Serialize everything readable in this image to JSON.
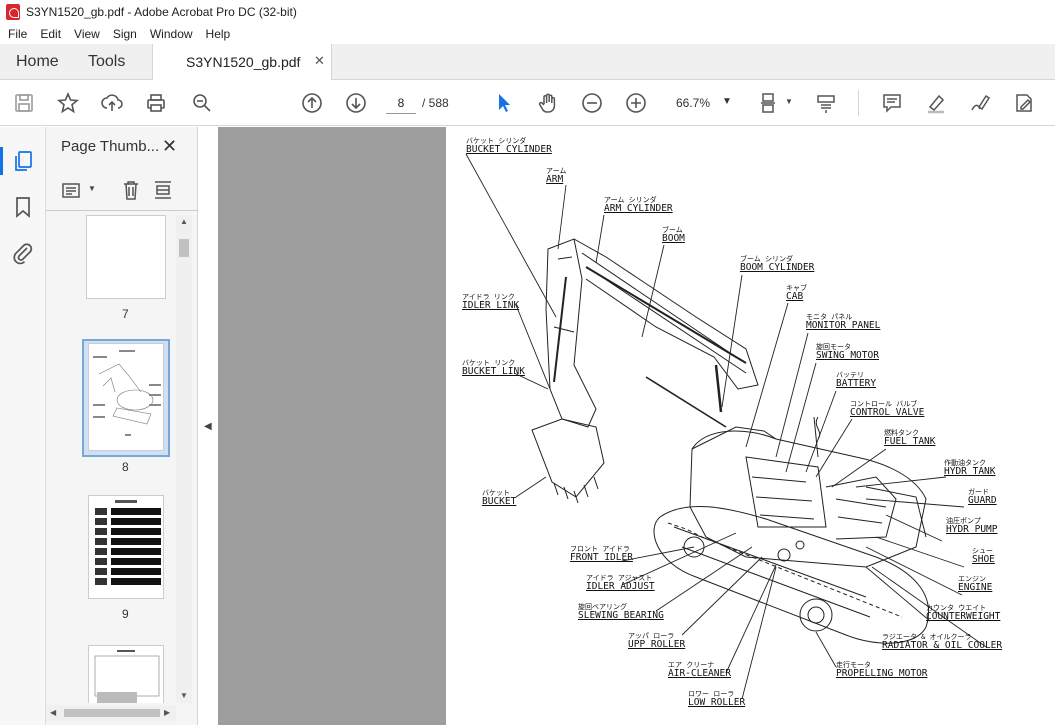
{
  "window": {
    "title": "S3YN1520_gb.pdf - Adobe Acrobat Pro DC (32-bit)"
  },
  "menu": [
    "File",
    "Edit",
    "View",
    "Sign",
    "Window",
    "Help"
  ],
  "tabs": {
    "home": "Home",
    "tools": "Tools",
    "document": "S3YN1520_gb.pdf"
  },
  "toolbar": {
    "page_current": "8",
    "page_total": "/ 588",
    "zoom": "66.7%"
  },
  "thumbnails": {
    "title": "Page Thumb...",
    "pages": [
      {
        "label": "7"
      },
      {
        "label": "8",
        "selected": true
      },
      {
        "label": "9"
      }
    ]
  },
  "diagram_labels": [
    {
      "jp": "バケット シリンダ",
      "en": "BUCKET CYLINDER"
    },
    {
      "jp": "アーム",
      "en": "ARM"
    },
    {
      "jp": "アーム シリンダ",
      "en": "ARM CYLINDER"
    },
    {
      "jp": "ブーム",
      "en": "BOOM"
    },
    {
      "jp": "ブーム シリンダ",
      "en": "BOOM CYLINDER"
    },
    {
      "jp": "キャブ",
      "en": "CAB"
    },
    {
      "jp": "モニタ パネル",
      "en": "MONITOR PANEL"
    },
    {
      "jp": "旋回モータ",
      "en": "SWING MOTOR"
    },
    {
      "jp": "バッテリ",
      "en": "BATTERY"
    },
    {
      "jp": "コントロール バルブ",
      "en": "CONTROL VALVE"
    },
    {
      "jp": "燃料タンク",
      "en": "FUEL TANK"
    },
    {
      "jp": "作動油タンク",
      "en": "HYDR TANK"
    },
    {
      "jp": "ガード",
      "en": "GUARD"
    },
    {
      "jp": "油圧ポンプ",
      "en": "HYDR PUMP"
    },
    {
      "jp": "シュー",
      "en": "SHOE"
    },
    {
      "jp": "エンジン",
      "en": "ENGINE"
    },
    {
      "jp": "カウンタ ウエイト",
      "en": "COUNTERWEIGHT"
    },
    {
      "jp": "ラジエータ & オイルクーラ",
      "en": "RADIATOR & OIL COOLER"
    },
    {
      "jp": "走行モータ",
      "en": "PROPELLING MOTOR"
    },
    {
      "jp": "ロワー ローラ",
      "en": "LOW ROLLER"
    },
    {
      "jp": "エア クリーナ",
      "en": "AIR-CLEANER"
    },
    {
      "jp": "アッパ ローラ",
      "en": "UPP ROLLER"
    },
    {
      "jp": "旋回ベアリング",
      "en": "SLEWING BEARING"
    },
    {
      "jp": "アイドラ アジャスト",
      "en": "IDLER ADJUST"
    },
    {
      "jp": "フロント アイドラ",
      "en": "FRONT IDLER"
    },
    {
      "jp": "バケット",
      "en": "BUCKET"
    },
    {
      "jp": "バケット リンク",
      "en": "BUCKET LINK"
    },
    {
      "jp": "アイドラ リンク",
      "en": "IDLER LINK"
    }
  ]
}
